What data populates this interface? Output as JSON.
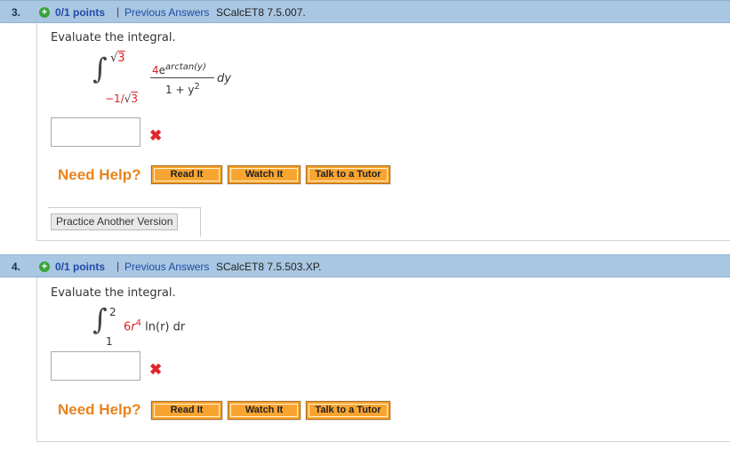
{
  "questions": [
    {
      "number": "3.",
      "plus_icon": "+",
      "points": "0/1 points",
      "separator": "|",
      "previous_answers": "Previous Answers",
      "source": "SCalcET8 7.5.007.",
      "prompt": "Evaluate the integral.",
      "integral": {
        "upper": "3",
        "lower_prefix": "−1/",
        "lower_root": "3",
        "numerator_coef": "4",
        "numerator_e": "e",
        "numerator_exp": "arctan(y)",
        "denominator": "1 + y",
        "denominator_exp": "2",
        "differential": "dy"
      },
      "answer_value": "",
      "status_icon": "✖",
      "need_help": "Need Help?",
      "buttons": [
        "Read It",
        "Watch It",
        "Talk to a Tutor"
      ],
      "practice_label": "Practice Another Version"
    },
    {
      "number": "4.",
      "plus_icon": "+",
      "points": "0/1 points",
      "separator": "|",
      "previous_answers": "Previous Answers",
      "source": "SCalcET8 7.5.503.XP.",
      "prompt": "Evaluate the integral.",
      "integral": {
        "upper": "2",
        "lower": "1",
        "coef": "6",
        "var": "r",
        "exp": "4",
        "rest": " ln(r) dr"
      },
      "answer_value": "",
      "status_icon": "✖",
      "need_help": "Need Help?",
      "buttons": [
        "Read It",
        "Watch It",
        "Talk to a Tutor"
      ]
    }
  ],
  "colors": {
    "header_bg": "#a9c7e2",
    "link": "#1f4aa8",
    "help_orange": "#e8831e",
    "button_orange": "#f8a431",
    "error_red": "#e02828"
  }
}
